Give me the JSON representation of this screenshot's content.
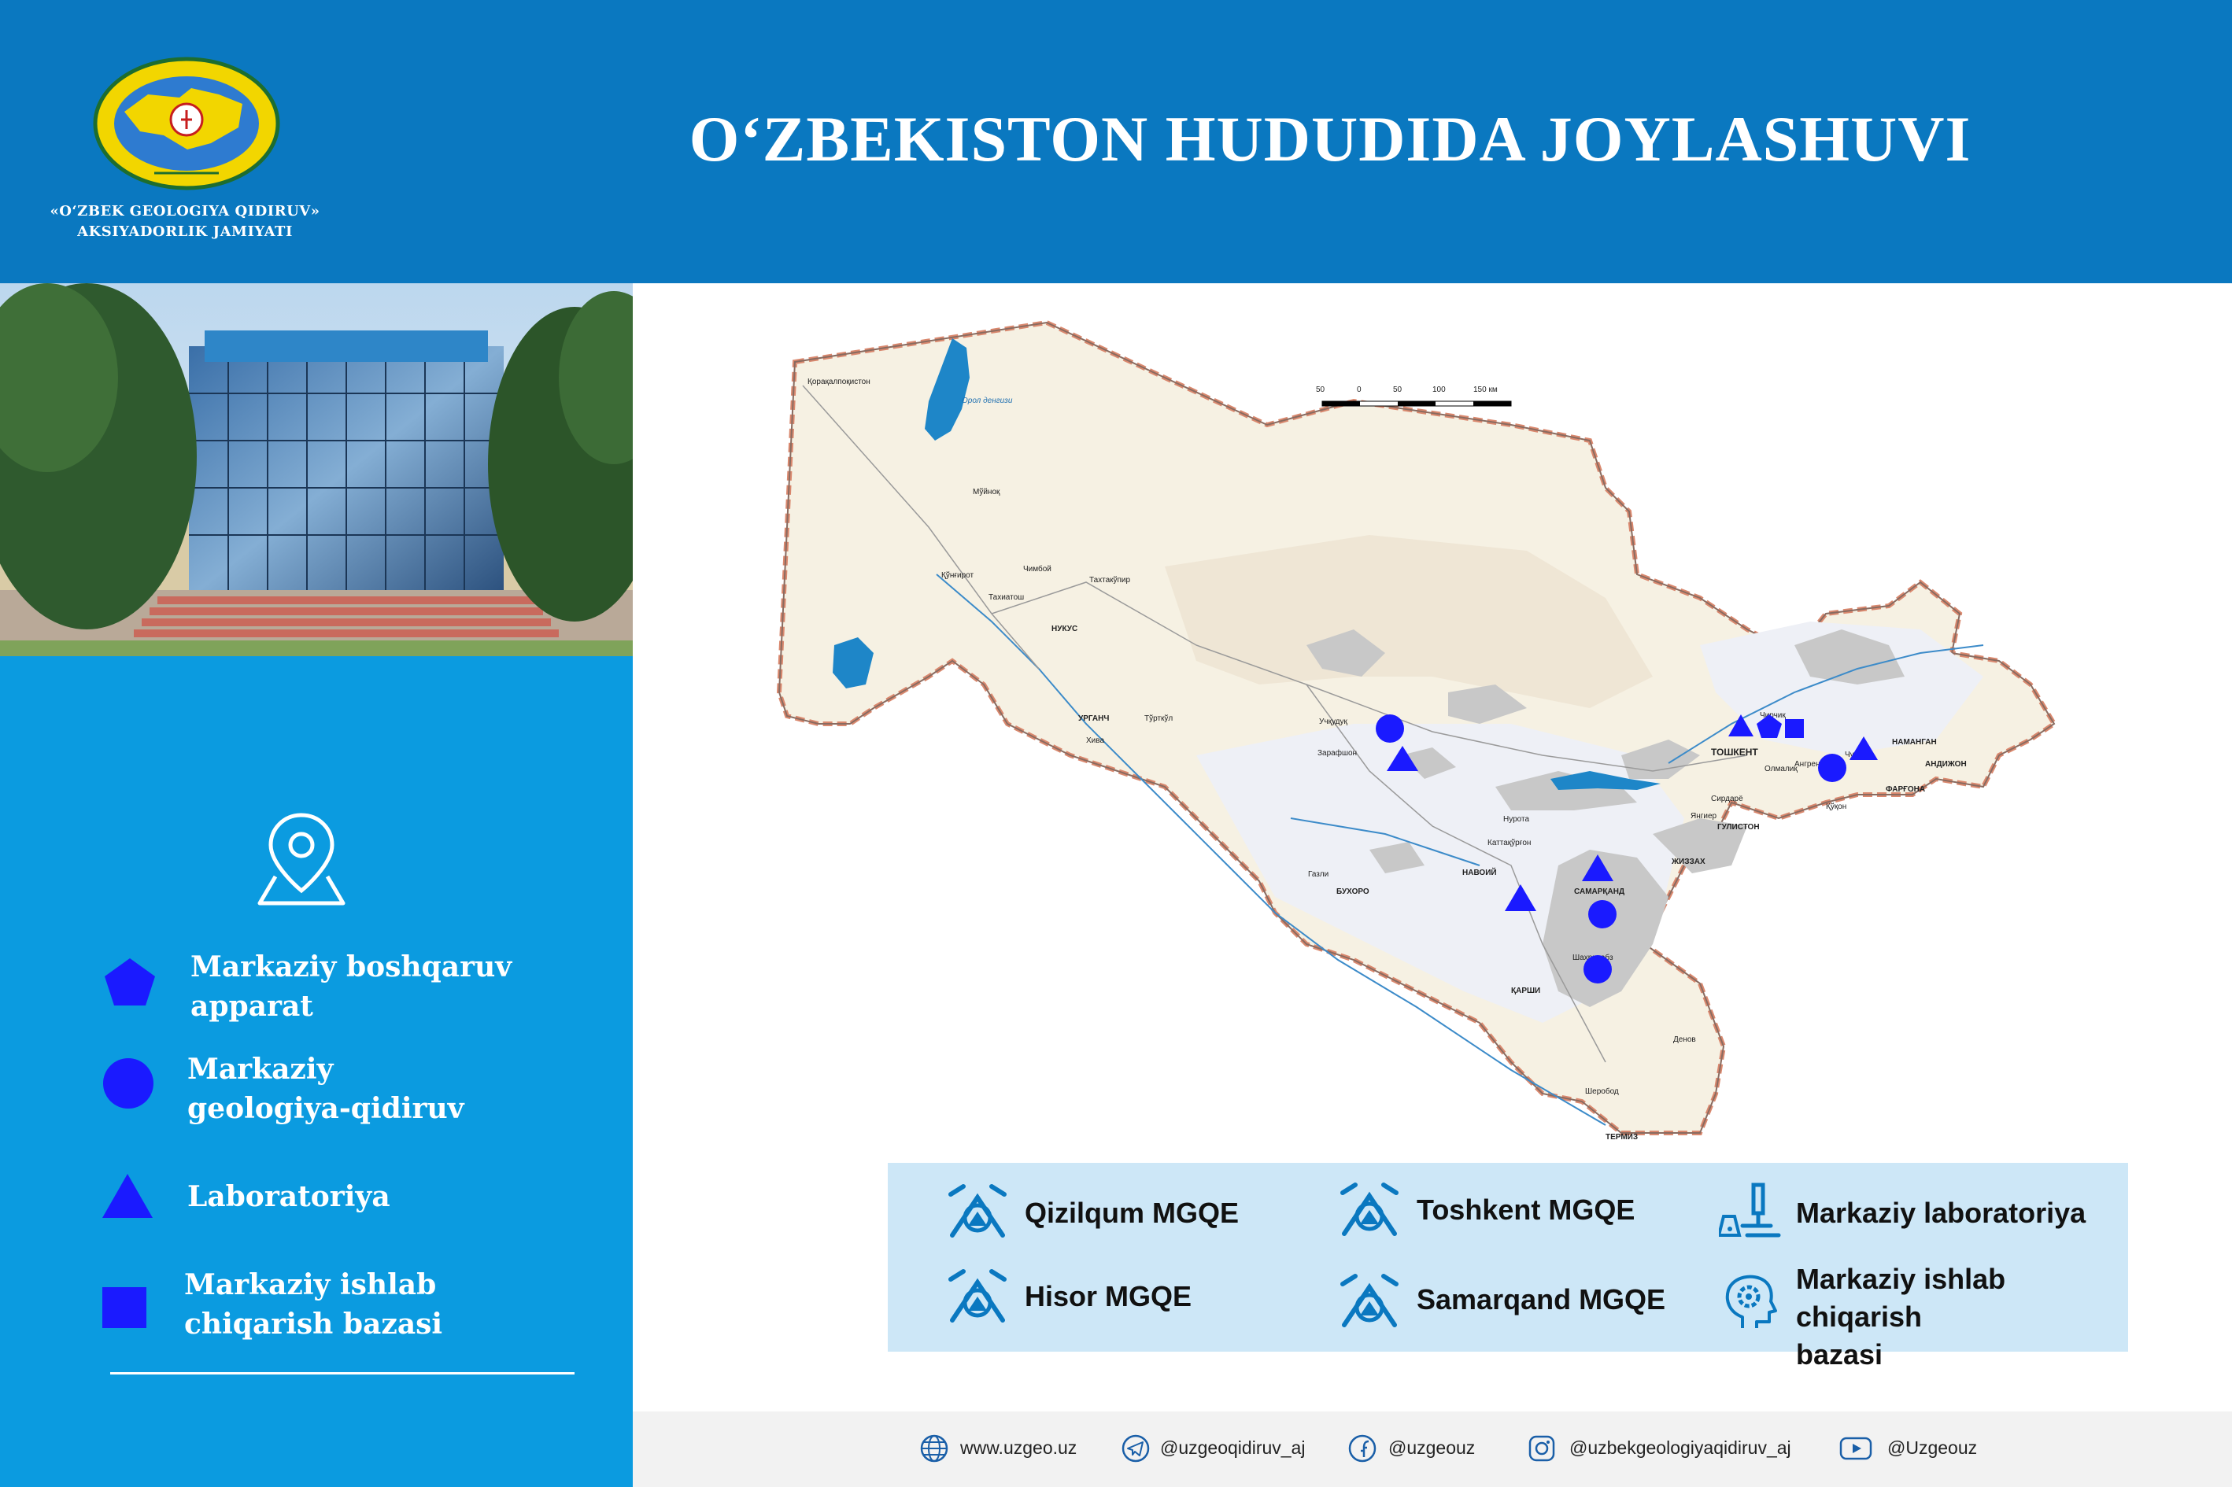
{
  "header": {
    "title": "O‘ZBEKISTON HUDUDIDA JOYLASHUVI",
    "org_line1": "«O‘ZBEK GEOLOGIYA QIDIRUV»",
    "org_line2": "AKSIYADORLIK JAMIYATI",
    "logo_ring_text": "O‘ZBEK GEOLOGIYA QIDIRUV AKSIYADORLIK JAMIYATI"
  },
  "legend": {
    "icon": "location-pin-icon",
    "items": [
      {
        "shape": "pentagon",
        "label_line1": "Markaziy boshqaruv",
        "label_line2": "apparat"
      },
      {
        "shape": "circle",
        "label_line1": "Markaziy",
        "label_line2": "geologiya-qidiruv"
      },
      {
        "shape": "triangle",
        "label_line1": "Laboratoriya",
        "label_line2": ""
      },
      {
        "shape": "square",
        "label_line1": "Markaziy ishlab",
        "label_line2": "chiqarish bazasi"
      }
    ]
  },
  "map": {
    "scale_labels": [
      "50",
      "0",
      "50",
      "100",
      "150 км"
    ],
    "sea_label": "Орол денгизи",
    "places": [
      {
        "name": "Қорақалпоқистон"
      },
      {
        "name": "Мўйноқ"
      },
      {
        "name": "Қўнғирот"
      },
      {
        "name": "Чимбой"
      },
      {
        "name": "Тахиатош"
      },
      {
        "name": "Тахтакўпир"
      },
      {
        "name": "НУКУС"
      },
      {
        "name": "УРГАНЧ"
      },
      {
        "name": "Тўрткўл"
      },
      {
        "name": "Хива"
      },
      {
        "name": "Учқудуқ"
      },
      {
        "name": "Зарафшон"
      },
      {
        "name": "Нурота"
      },
      {
        "name": "НАВОИЙ"
      },
      {
        "name": "БУХОРО"
      },
      {
        "name": "Газли"
      },
      {
        "name": "САМАРҚАНД"
      },
      {
        "name": "Шаҳрисабз"
      },
      {
        "name": "ҚАРШИ"
      },
      {
        "name": "Денов"
      },
      {
        "name": "Шеробод"
      },
      {
        "name": "ТЕРМИЗ"
      },
      {
        "name": "ЖИЗЗАХ"
      },
      {
        "name": "ГУЛИСТОН"
      },
      {
        "name": "Сирдарё"
      },
      {
        "name": "ТОШКЕНТ"
      },
      {
        "name": "Олмалиқ"
      },
      {
        "name": "Ангрен"
      },
      {
        "name": "НАМАНГАН"
      },
      {
        "name": "АНДИЖОН"
      },
      {
        "name": "ФАРҒОНА"
      },
      {
        "name": "Қўқон"
      },
      {
        "name": "Чуст"
      },
      {
        "name": "Чирчиқ"
      },
      {
        "name": "Янгиер"
      },
      {
        "name": "Каттақўрғон"
      }
    ],
    "markers": [
      {
        "shape": "circle",
        "near": "Зарафшон"
      },
      {
        "shape": "triangle",
        "near": "Зарафшон"
      },
      {
        "shape": "triangle",
        "near": "ТОШКЕНТ"
      },
      {
        "shape": "pentagon",
        "near": "ТОШКЕНТ"
      },
      {
        "shape": "square",
        "near": "ТОШКЕНТ"
      },
      {
        "shape": "circle",
        "near": "Ангрен"
      },
      {
        "shape": "triangle",
        "near": "Ангрен"
      },
      {
        "shape": "triangle",
        "near": "САМАРҚАНД"
      },
      {
        "shape": "triangle",
        "near": "НАВОИЙ"
      },
      {
        "shape": "circle",
        "near": "САМАРҚАНД"
      },
      {
        "shape": "circle",
        "near": "Шаҳрисабз"
      }
    ]
  },
  "info": {
    "items": [
      {
        "label": "Qizilqum MGQE",
        "icon": "crossed-hammers-mountain-icon"
      },
      {
        "label": "Toshkent MGQE",
        "icon": "crossed-hammers-mountain-icon"
      },
      {
        "label": "Markaziy laboratoriya",
        "icon": "microscope-icon"
      },
      {
        "label": "Hisor MGQE",
        "icon": "crossed-hammers-mountain-icon"
      },
      {
        "label": "Samarqand MGQE",
        "icon": "crossed-hammers-mountain-icon"
      },
      {
        "label_line1": "Markaziy ishlab chiqarish",
        "label_line2": "bazasi",
        "icon": "gear-head-icon"
      }
    ]
  },
  "footer": {
    "website": "www.uzgeo.uz",
    "telegram": "@uzgeoqidiruv_aj",
    "facebook": "@uzgeouz",
    "instagram": "@uzbekgeologiyaqidiruv_aj",
    "youtube": "@Uzgeouz"
  },
  "colors": {
    "header_blue": "#0a78c0",
    "panel_blue": "#0b9be0",
    "marker_blue": "#1a1aff",
    "info_bg": "#cde7f7",
    "icon_blue": "#0a78c0"
  }
}
